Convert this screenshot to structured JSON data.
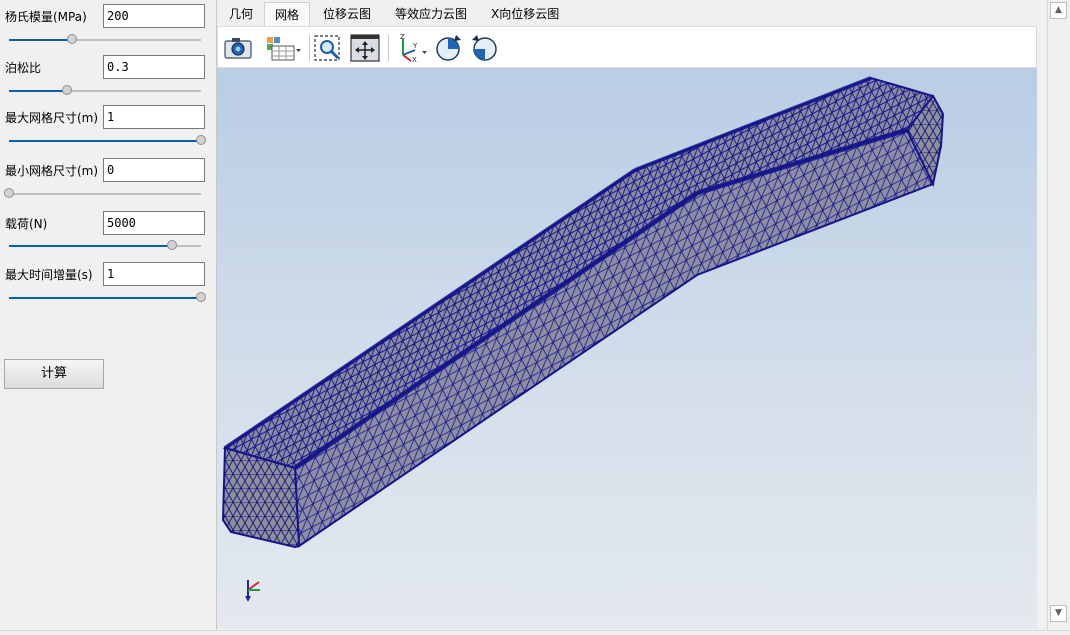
{
  "params": [
    {
      "label": "杨氏模量(MPa)",
      "value": "200",
      "slider_fraction": 0.33
    },
    {
      "label": "泊松比",
      "value": "0.3",
      "slider_fraction": 0.3
    },
    {
      "label": "最大网格尺寸(m)",
      "value": "1",
      "slider_fraction": 1.0
    },
    {
      "label": "最小网格尺寸(m)",
      "value": "0",
      "slider_fraction": 0.0
    },
    {
      "label": "载荷(N)",
      "value": "5000",
      "slider_fraction": 0.85
    },
    {
      "label": "最大时间增量(s)",
      "value": "1",
      "slider_fraction": 1.0
    }
  ],
  "calc_button": "计算",
  "tabs": [
    {
      "label": "几何",
      "active": false
    },
    {
      "label": "网格",
      "active": true
    },
    {
      "label": "位移云图",
      "active": false
    },
    {
      "label": "等效应力云图",
      "active": false
    },
    {
      "label": "X向位移云图",
      "active": false
    }
  ],
  "toolbar": [
    {
      "icon": "camera-icon"
    },
    {
      "icon": "display-mode-dropdown-icon"
    },
    {
      "icon": "zoom-window-icon"
    },
    {
      "icon": "pan-icon"
    },
    {
      "icon": "axis-view-dropdown-icon"
    },
    {
      "icon": "rotate-clockwise-icon"
    },
    {
      "icon": "rotate-counterclockwise-icon"
    }
  ],
  "colors": {
    "mesh_edge": "#14148c",
    "mesh_face": "#8a8aa0",
    "slider_fill": "#0b5fad",
    "viewport_top": "#b9cde4",
    "viewport_bottom": "#e4e9ef"
  }
}
